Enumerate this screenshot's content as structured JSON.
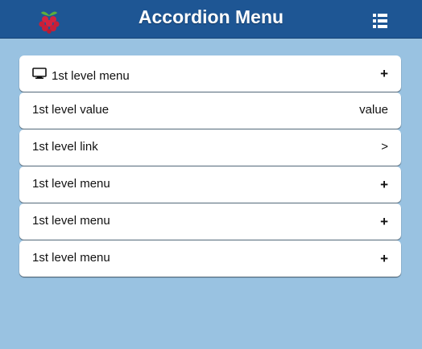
{
  "header": {
    "title": "Accordion Menu",
    "logo_icon": "raspberry-logo",
    "menu_icon": "list-icon",
    "bg_color": "#1e5694"
  },
  "page": {
    "bg_color": "#99c2e1"
  },
  "menu": {
    "items": [
      {
        "label": "1st level menu",
        "indicator": "+",
        "icon": "monitor-icon"
      },
      {
        "label": "1st level value",
        "value": "value"
      },
      {
        "label": "1st level link",
        "indicator": ">"
      },
      {
        "label": "1st level menu",
        "indicator": "+"
      },
      {
        "label": "1st level menu",
        "indicator": "+"
      },
      {
        "label": "1st level menu",
        "indicator": "+"
      }
    ]
  }
}
